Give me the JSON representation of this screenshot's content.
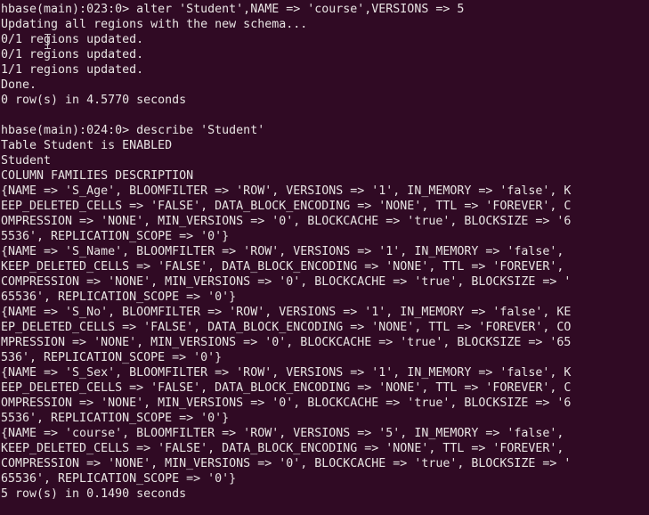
{
  "terminal": {
    "app": "hbase-shell",
    "columns": 79,
    "rows": 34,
    "background_color": "#300a24",
    "foreground_color": "#e8e4e3",
    "cursor_color": "#cfc9cc",
    "mouse_cursor": "text-ibeam-cursor"
  },
  "lines": [
    "hbase(main):023:0> alter 'Student',NAME => 'course',VERSIONS => 5",
    "Updating all regions with the new schema...",
    "0/1 regions updated.",
    "0/1 regions updated.",
    "1/1 regions updated.",
    "Done.",
    "0 row(s) in 4.5770 seconds",
    "",
    "hbase(main):024:0> describe 'Student'",
    "Table Student is ENABLED",
    "Student",
    "COLUMN FAMILIES DESCRIPTION",
    "{NAME => 'S_Age', BLOOMFILTER => 'ROW', VERSIONS => '1', IN_MEMORY => 'false', K",
    "EEP_DELETED_CELLS => 'FALSE', DATA_BLOCK_ENCODING => 'NONE', TTL => 'FOREVER', C",
    "OMPRESSION => 'NONE', MIN_VERSIONS => '0', BLOCKCACHE => 'true', BLOCKSIZE => '6",
    "5536', REPLICATION_SCOPE => '0'}",
    "{NAME => 'S_Name', BLOOMFILTER => 'ROW', VERSIONS => '1', IN_MEMORY => 'false', ",
    "KEEP_DELETED_CELLS => 'FALSE', DATA_BLOCK_ENCODING => 'NONE', TTL => 'FOREVER', ",
    "COMPRESSION => 'NONE', MIN_VERSIONS => '0', BLOCKCACHE => 'true', BLOCKSIZE => '",
    "65536', REPLICATION_SCOPE => '0'}",
    "{NAME => 'S_No', BLOOMFILTER => 'ROW', VERSIONS => '1', IN_MEMORY => 'false', KE",
    "EP_DELETED_CELLS => 'FALSE', DATA_BLOCK_ENCODING => 'NONE', TTL => 'FOREVER', CO",
    "MPRESSION => 'NONE', MIN_VERSIONS => '0', BLOCKCACHE => 'true', BLOCKSIZE => '65",
    "536', REPLICATION_SCOPE => '0'}",
    "{NAME => 'S_Sex', BLOOMFILTER => 'ROW', VERSIONS => '1', IN_MEMORY => 'false', K",
    "EEP_DELETED_CELLS => 'FALSE', DATA_BLOCK_ENCODING => 'NONE', TTL => 'FOREVER', C",
    "OMPRESSION => 'NONE', MIN_VERSIONS => '0', BLOCKCACHE => 'true', BLOCKSIZE => '6",
    "5536', REPLICATION_SCOPE => '0'}",
    "{NAME => 'course', BLOOMFILTER => 'ROW', VERSIONS => '5', IN_MEMORY => 'false', ",
    "KEEP_DELETED_CELLS => 'FALSE', DATA_BLOCK_ENCODING => 'NONE', TTL => 'FOREVER', ",
    "COMPRESSION => 'NONE', MIN_VERSIONS => '0', BLOCKCACHE => 'true', BLOCKSIZE => '",
    "65536', REPLICATION_SCOPE => '0'}",
    "5 row(s) in 0.1490 seconds",
    ""
  ]
}
